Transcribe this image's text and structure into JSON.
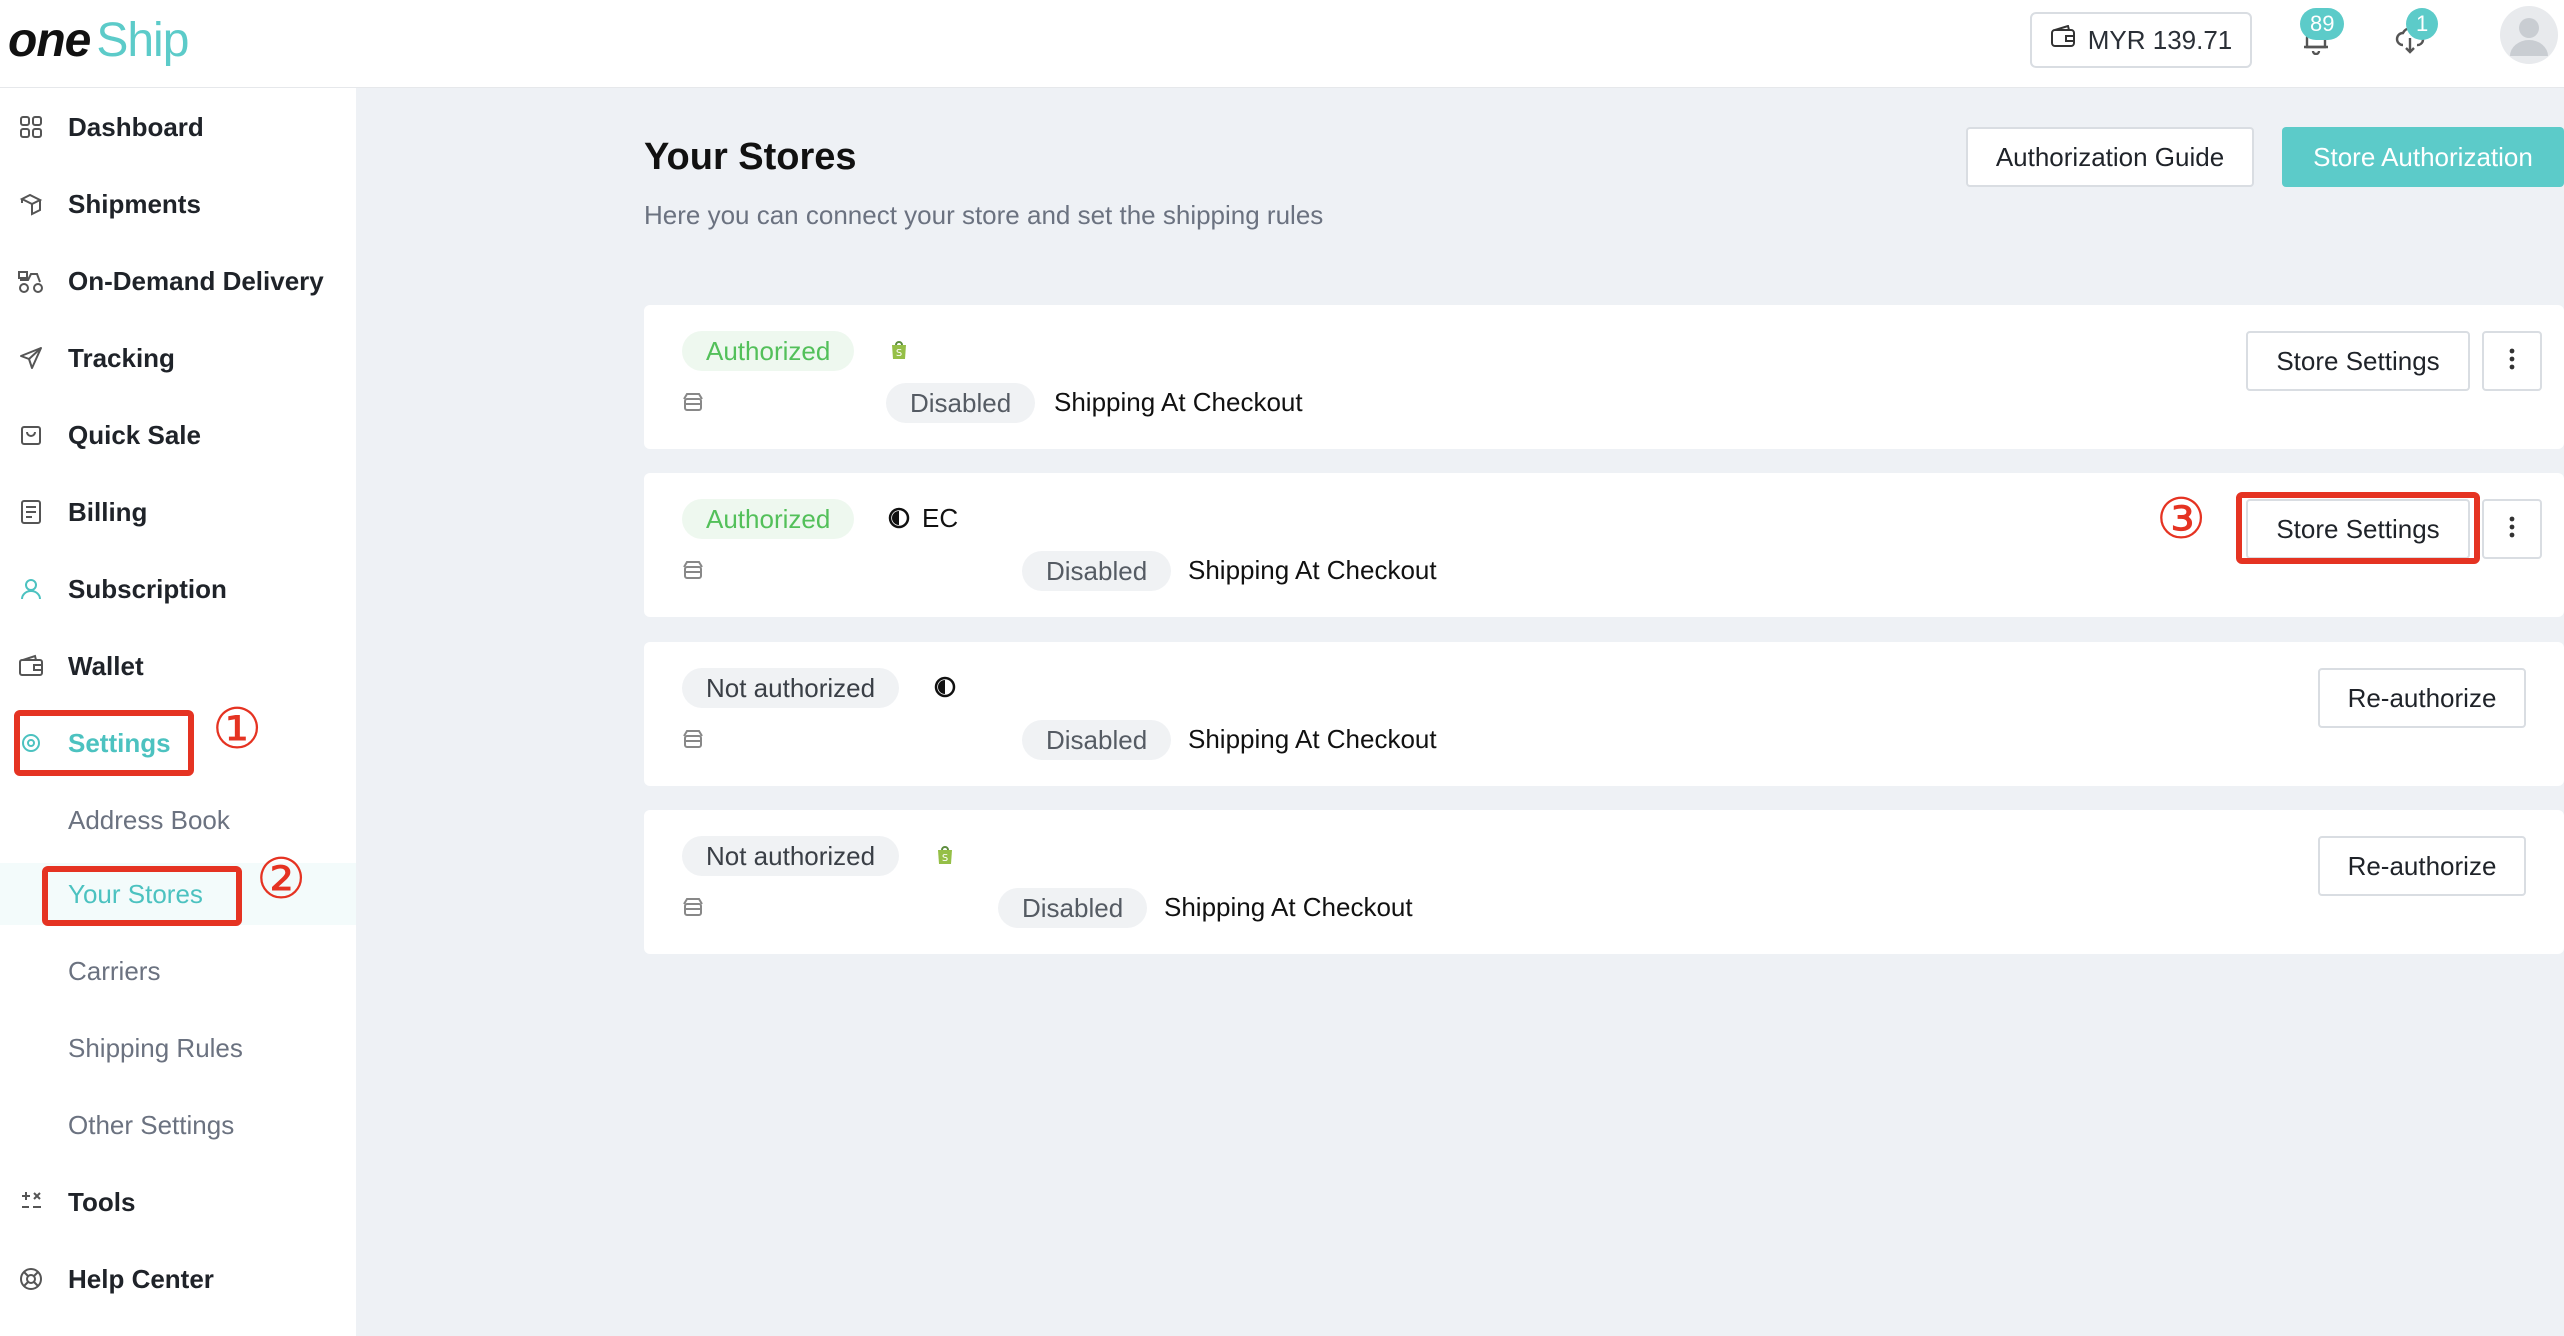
{
  "header": {
    "logo_one": "one",
    "logo_ship": "Ship",
    "wallet_balance": "MYR 139.71",
    "notification_count": "89",
    "download_count": "1"
  },
  "sidebar": {
    "items": [
      {
        "label": "Dashboard"
      },
      {
        "label": "Shipments"
      },
      {
        "label": "On-Demand Delivery"
      },
      {
        "label": "Tracking"
      },
      {
        "label": "Quick Sale"
      },
      {
        "label": "Billing"
      },
      {
        "label": "Subscription"
      },
      {
        "label": "Wallet"
      },
      {
        "label": "Settings"
      },
      {
        "label": "Address Book"
      },
      {
        "label": "Your Stores"
      },
      {
        "label": "Carriers"
      },
      {
        "label": "Shipping Rules"
      },
      {
        "label": "Other Settings"
      },
      {
        "label": "Tools"
      },
      {
        "label": "Help Center"
      }
    ]
  },
  "main": {
    "title": "Your Stores",
    "subtitle": "Here you can connect your store and set the shipping rules",
    "auth_guide_label": "Authorization Guide",
    "store_auth_label": "Store Authorization",
    "stores": [
      {
        "status": "Authorized",
        "name": "",
        "shipping_status": "Disabled",
        "shipping_label": "Shipping At Checkout",
        "action": "Store Settings"
      },
      {
        "status": "Authorized",
        "name": "EC",
        "shipping_status": "Disabled",
        "shipping_label": "Shipping At Checkout",
        "action": "Store Settings"
      },
      {
        "status": "Not authorized",
        "name": "",
        "shipping_status": "Disabled",
        "shipping_label": "Shipping At Checkout",
        "action": "Re-authorize"
      },
      {
        "status": "Not authorized",
        "name": "",
        "shipping_status": "Disabled",
        "shipping_label": "Shipping At Checkout",
        "action": "Re-authorize"
      }
    ]
  },
  "annotations": [
    "①",
    "②",
    "③"
  ],
  "colors": {
    "accent": "#5ccbc9",
    "authorized": "#53c05a",
    "annotation": "#e53322"
  }
}
